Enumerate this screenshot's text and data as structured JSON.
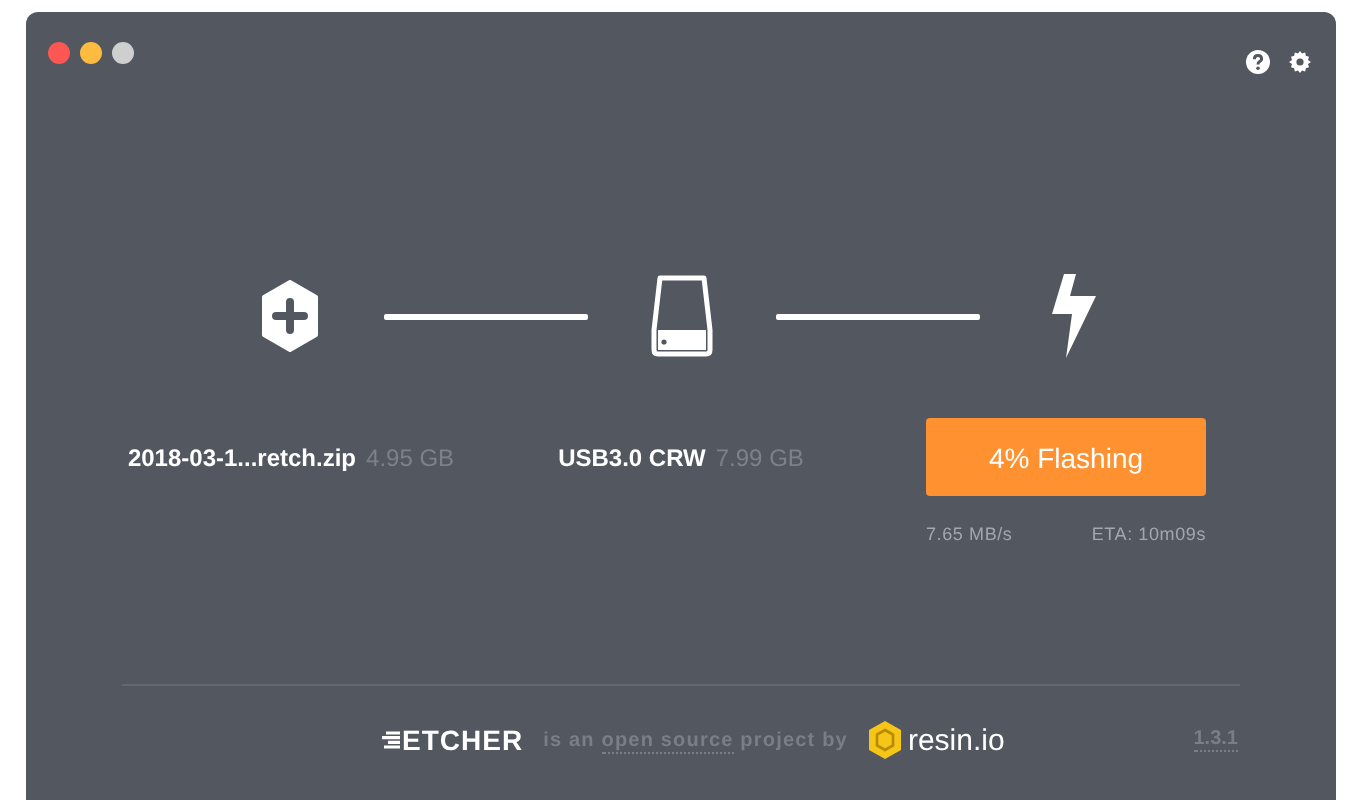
{
  "steps": [
    {
      "kind": "image",
      "title": "2018-03-1...retch.zip",
      "size": "4.95 GB"
    },
    {
      "kind": "drive",
      "title": "USB3.0 CRW",
      "size": "7.99 GB"
    },
    {
      "kind": "flash",
      "button": "4% Flashing",
      "speed": "7.65 MB/s",
      "eta": "ETA: 10m09s"
    }
  ],
  "footer": {
    "logo": "ETCHER",
    "tagline_before": "is an ",
    "link": "open source",
    "tagline_after": " project by",
    "brand": "resin.io",
    "version": "1.3.1"
  }
}
